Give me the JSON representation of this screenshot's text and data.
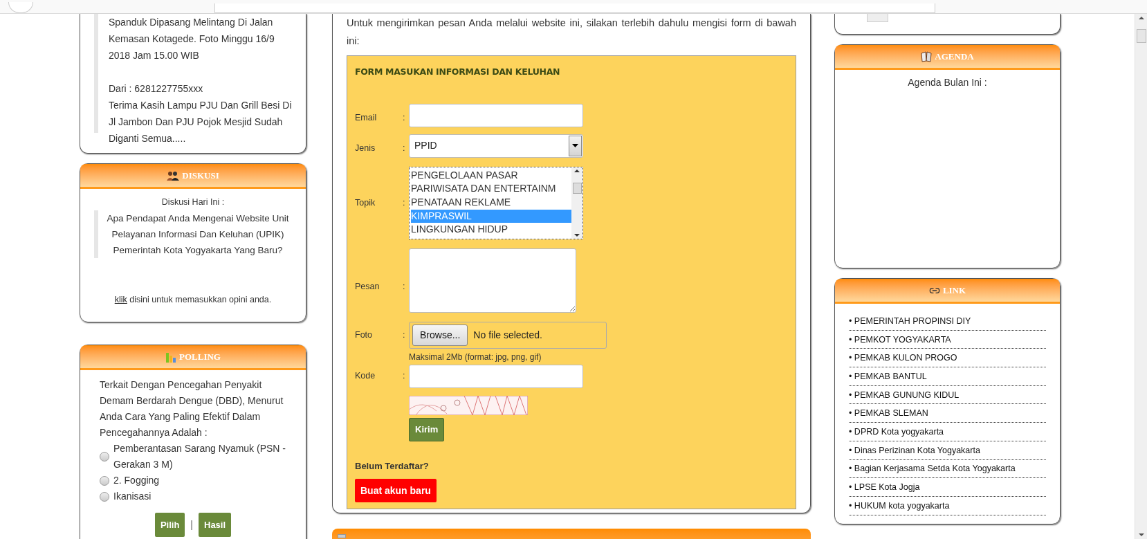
{
  "news": {
    "paragraphs": [
      "Spanduk Dipasang Melintang Di Jalan Kemasan Kotagede. Foto Minggu 16/9 2018 Jam 15.00 WIB",
      "Dari : 6281227755xxx",
      "Terima Kasih Lampu PJU Dan Grill Besi Di Jl Jambon Dan PJU Pojok Mesjid Sudah Diganti Semua....."
    ]
  },
  "discussion": {
    "title": "DISKUSI",
    "subtitle": "Diskusi Hari Ini :",
    "question": "Apa Pendapat Anda Mengenai Website Unit Pelayanan Informasi Dan Keluhan (UPIK) Pemerintah Kota Yogyakarta Yang Baru?",
    "link": "klik",
    "prompt": " disini untuk memasukkan opini anda."
  },
  "polling": {
    "title": "POLLING",
    "question": "Terkait Dengan Pencegahan Penyakit Demam Berdarah Dengue (DBD), Menurut Anda Cara Yang Paling Efektif Dalam Pencegahannya Adalah :",
    "options": [
      {
        "label": "Pemberantasan Sarang Nyamuk (PSN - Gerakan 3 M)",
        "selected": false
      },
      {
        "label": "2. Fogging",
        "selected": false
      },
      {
        "label": "Ikanisasi",
        "selected": false
      }
    ],
    "buttons": [
      "Pilih",
      "Hasil"
    ],
    "separator": "|"
  },
  "intro": "Untuk mengirimkan pesan Anda melalui website ini, silakan terlebih dahulu mengisi form di bawah ini:",
  "form": {
    "title": "FORM MASUKAN INFORMASI DAN KELUHAN",
    "colon": ":",
    "email_label": "Email",
    "jenis_label": "Jenis",
    "jenis_value": "PPID",
    "topik_label": "Topik",
    "topics": [
      {
        "label": "PENGELOLAAN PASAR",
        "selected": false
      },
      {
        "label": "PARIWISATA DAN ENTERTAINM",
        "selected": false
      },
      {
        "label": "PENATAAN REKLAME",
        "selected": false
      },
      {
        "label": "KIMPRASWIL",
        "selected": true
      },
      {
        "label": "LINGKUNGAN HIDUP",
        "selected": false
      }
    ],
    "pesan_label": "Pesan",
    "foto_label": "Foto",
    "browse": "Browse...",
    "no_file": "No file selected.",
    "foto_note": "Maksimal 2Mb (format: jpg, png, gif)",
    "kode_label": "Kode",
    "submit": "Kirim",
    "register_prompt": "Belum Terdaftar?",
    "register_button": "Buat akun baru"
  },
  "agenda": {
    "title": "AGENDA",
    "subtitle": "Agenda Bulan Ini :"
  },
  "links": {
    "title": "LINK",
    "items": [
      "• PEMERINTAH PROPINSI DIY",
      "• PEMKOT YOGYAKARTA",
      "• PEMKAB KULON PROGO",
      "• PEMKAB BANTUL",
      "• PEMKAB GUNUNG KIDUL",
      "• PEMKAB SLEMAN",
      "• DPRD Kota yogyakarta",
      "• Dinas Perizinan Kota Yogyakarta",
      "• Bagian Kerjasama Setda Kota Yogyakarta",
      "• LPSE Kota Jogja",
      "• HUKUM kota yogyakarta"
    ]
  }
}
